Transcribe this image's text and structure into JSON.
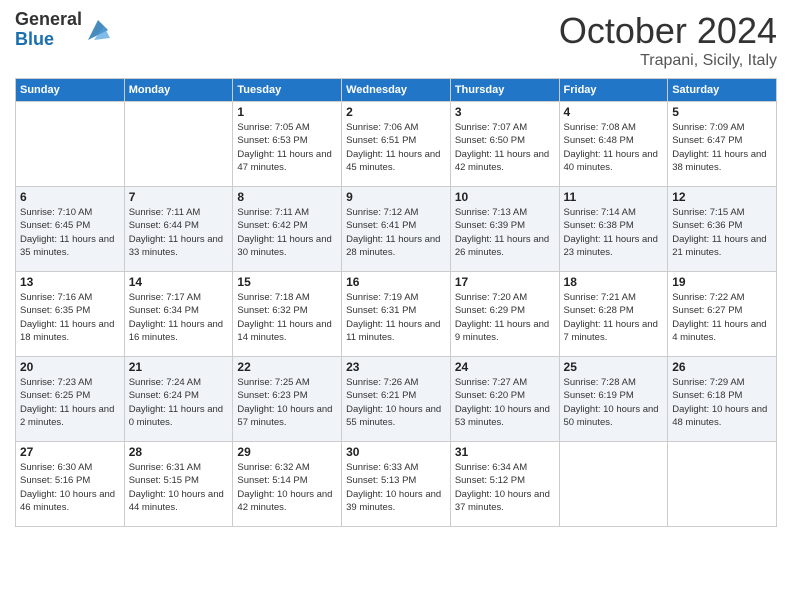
{
  "header": {
    "logo_general": "General",
    "logo_blue": "Blue",
    "month_title": "October 2024",
    "location": "Trapani, Sicily, Italy"
  },
  "weekdays": [
    "Sunday",
    "Monday",
    "Tuesday",
    "Wednesday",
    "Thursday",
    "Friday",
    "Saturday"
  ],
  "weeks": [
    [
      {
        "day": "",
        "info": ""
      },
      {
        "day": "",
        "info": ""
      },
      {
        "day": "1",
        "info": "Sunrise: 7:05 AM\nSunset: 6:53 PM\nDaylight: 11 hours and 47 minutes."
      },
      {
        "day": "2",
        "info": "Sunrise: 7:06 AM\nSunset: 6:51 PM\nDaylight: 11 hours and 45 minutes."
      },
      {
        "day": "3",
        "info": "Sunrise: 7:07 AM\nSunset: 6:50 PM\nDaylight: 11 hours and 42 minutes."
      },
      {
        "day": "4",
        "info": "Sunrise: 7:08 AM\nSunset: 6:48 PM\nDaylight: 11 hours and 40 minutes."
      },
      {
        "day": "5",
        "info": "Sunrise: 7:09 AM\nSunset: 6:47 PM\nDaylight: 11 hours and 38 minutes."
      }
    ],
    [
      {
        "day": "6",
        "info": "Sunrise: 7:10 AM\nSunset: 6:45 PM\nDaylight: 11 hours and 35 minutes."
      },
      {
        "day": "7",
        "info": "Sunrise: 7:11 AM\nSunset: 6:44 PM\nDaylight: 11 hours and 33 minutes."
      },
      {
        "day": "8",
        "info": "Sunrise: 7:11 AM\nSunset: 6:42 PM\nDaylight: 11 hours and 30 minutes."
      },
      {
        "day": "9",
        "info": "Sunrise: 7:12 AM\nSunset: 6:41 PM\nDaylight: 11 hours and 28 minutes."
      },
      {
        "day": "10",
        "info": "Sunrise: 7:13 AM\nSunset: 6:39 PM\nDaylight: 11 hours and 26 minutes."
      },
      {
        "day": "11",
        "info": "Sunrise: 7:14 AM\nSunset: 6:38 PM\nDaylight: 11 hours and 23 minutes."
      },
      {
        "day": "12",
        "info": "Sunrise: 7:15 AM\nSunset: 6:36 PM\nDaylight: 11 hours and 21 minutes."
      }
    ],
    [
      {
        "day": "13",
        "info": "Sunrise: 7:16 AM\nSunset: 6:35 PM\nDaylight: 11 hours and 18 minutes."
      },
      {
        "day": "14",
        "info": "Sunrise: 7:17 AM\nSunset: 6:34 PM\nDaylight: 11 hours and 16 minutes."
      },
      {
        "day": "15",
        "info": "Sunrise: 7:18 AM\nSunset: 6:32 PM\nDaylight: 11 hours and 14 minutes."
      },
      {
        "day": "16",
        "info": "Sunrise: 7:19 AM\nSunset: 6:31 PM\nDaylight: 11 hours and 11 minutes."
      },
      {
        "day": "17",
        "info": "Sunrise: 7:20 AM\nSunset: 6:29 PM\nDaylight: 11 hours and 9 minutes."
      },
      {
        "day": "18",
        "info": "Sunrise: 7:21 AM\nSunset: 6:28 PM\nDaylight: 11 hours and 7 minutes."
      },
      {
        "day": "19",
        "info": "Sunrise: 7:22 AM\nSunset: 6:27 PM\nDaylight: 11 hours and 4 minutes."
      }
    ],
    [
      {
        "day": "20",
        "info": "Sunrise: 7:23 AM\nSunset: 6:25 PM\nDaylight: 11 hours and 2 minutes."
      },
      {
        "day": "21",
        "info": "Sunrise: 7:24 AM\nSunset: 6:24 PM\nDaylight: 11 hours and 0 minutes."
      },
      {
        "day": "22",
        "info": "Sunrise: 7:25 AM\nSunset: 6:23 PM\nDaylight: 10 hours and 57 minutes."
      },
      {
        "day": "23",
        "info": "Sunrise: 7:26 AM\nSunset: 6:21 PM\nDaylight: 10 hours and 55 minutes."
      },
      {
        "day": "24",
        "info": "Sunrise: 7:27 AM\nSunset: 6:20 PM\nDaylight: 10 hours and 53 minutes."
      },
      {
        "day": "25",
        "info": "Sunrise: 7:28 AM\nSunset: 6:19 PM\nDaylight: 10 hours and 50 minutes."
      },
      {
        "day": "26",
        "info": "Sunrise: 7:29 AM\nSunset: 6:18 PM\nDaylight: 10 hours and 48 minutes."
      }
    ],
    [
      {
        "day": "27",
        "info": "Sunrise: 6:30 AM\nSunset: 5:16 PM\nDaylight: 10 hours and 46 minutes."
      },
      {
        "day": "28",
        "info": "Sunrise: 6:31 AM\nSunset: 5:15 PM\nDaylight: 10 hours and 44 minutes."
      },
      {
        "day": "29",
        "info": "Sunrise: 6:32 AM\nSunset: 5:14 PM\nDaylight: 10 hours and 42 minutes."
      },
      {
        "day": "30",
        "info": "Sunrise: 6:33 AM\nSunset: 5:13 PM\nDaylight: 10 hours and 39 minutes."
      },
      {
        "day": "31",
        "info": "Sunrise: 6:34 AM\nSunset: 5:12 PM\nDaylight: 10 hours and 37 minutes."
      },
      {
        "day": "",
        "info": ""
      },
      {
        "day": "",
        "info": ""
      }
    ]
  ]
}
